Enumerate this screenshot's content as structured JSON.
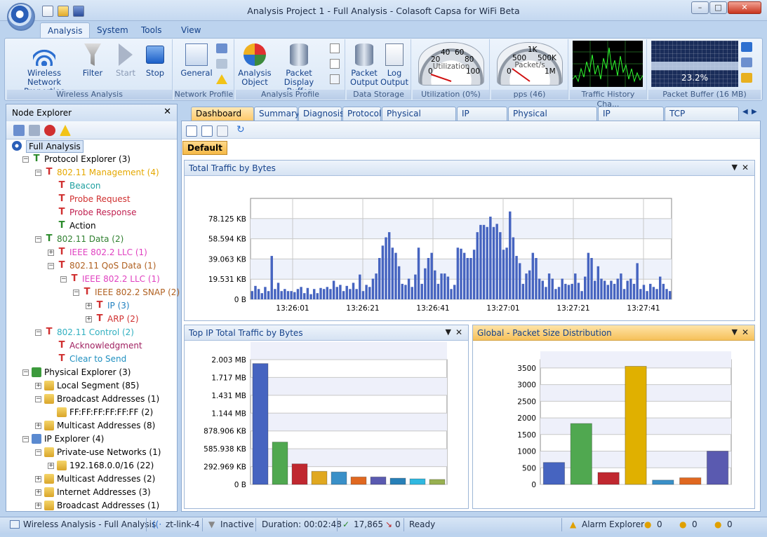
{
  "window": {
    "title": "Analysis Project 1 - Full Analysis - Colasoft Capsa for WiFi Beta"
  },
  "ribbon_tabs": [
    "Analysis",
    "System",
    "Tools",
    "View"
  ],
  "ribbon": {
    "wireless_network_properties": "Wireless Network Properties",
    "filter": "Filter",
    "start": "Start",
    "stop": "Stop",
    "general": "General",
    "analysis_object": "Analysis Object",
    "packet_display_buffer": "Packet Display Buffer",
    "packet_output": "Packet Output",
    "log_output": "Log Output",
    "groups": [
      "Wireless Analysis",
      "Network Profile",
      "Analysis Profile",
      "Data Storage",
      "Utilization (0%)",
      "pps (46)",
      "Traffic History Cha...",
      "Packet Buffer (16 MB)"
    ],
    "utilization_label": "Utilization",
    "utilization_ticks": [
      "0",
      "20",
      "40",
      "60",
      "80",
      "100"
    ],
    "pps_label": "Packet/s",
    "pps_ticks": [
      "0",
      "500",
      "1K",
      "500K",
      "1M"
    ],
    "buffer_percent": "23.2%"
  },
  "node_explorer": {
    "title": "Node Explorer",
    "tree": [
      {
        "label": "Full Analysis",
        "level": 0,
        "color": "#000000"
      },
      {
        "label": "Protocol Explorer (3)",
        "level": 1,
        "color": "#000000"
      },
      {
        "label": "802.11 Management (4)",
        "level": 2,
        "color": "#e5a800"
      },
      {
        "label": "Beacon",
        "level": 3,
        "color": "#20a0a0"
      },
      {
        "label": "Probe Request",
        "level": 3,
        "color": "#d03030"
      },
      {
        "label": "Probe Response",
        "level": 3,
        "color": "#c02050"
      },
      {
        "label": "Action",
        "level": 3,
        "color": "#000000"
      },
      {
        "label": "802.11 Data (2)",
        "level": 2,
        "color": "#308030"
      },
      {
        "label": "IEEE 802.2 LLC (1)",
        "level": 3,
        "color": "#e040c0"
      },
      {
        "label": "802.11 QoS Data (1)",
        "level": 3,
        "color": "#b06020"
      },
      {
        "label": "IEEE 802.2 LLC (1)",
        "level": 4,
        "color": "#e040c0"
      },
      {
        "label": "IEEE 802.2 SNAP (2)",
        "level": 5,
        "color": "#b06020"
      },
      {
        "label": "IP (3)",
        "level": 6,
        "color": "#2080c0"
      },
      {
        "label": "ARP (2)",
        "level": 6,
        "color": "#d03030"
      },
      {
        "label": "802.11 Control (2)",
        "level": 2,
        "color": "#30b0c0"
      },
      {
        "label": "Acknowledgment",
        "level": 3,
        "color": "#a02060"
      },
      {
        "label": "Clear to Send",
        "level": 3,
        "color": "#2090c0"
      },
      {
        "label": "Physical Explorer (3)",
        "level": 1,
        "color": "#000000"
      },
      {
        "label": "Local Segment (85)",
        "level": 2,
        "color": "#000000"
      },
      {
        "label": "Broadcast Addresses (1)",
        "level": 2,
        "color": "#000000"
      },
      {
        "label": "FF:FF:FF:FF:FF:FF (2)",
        "level": 3,
        "color": "#000000"
      },
      {
        "label": "Multicast Addresses (8)",
        "level": 2,
        "color": "#000000"
      },
      {
        "label": "IP Explorer (4)",
        "level": 1,
        "color": "#000000"
      },
      {
        "label": "Private-use Networks (1)",
        "level": 2,
        "color": "#000000"
      },
      {
        "label": "192.168.0.0/16 (22)",
        "level": 3,
        "color": "#000000"
      },
      {
        "label": "Multicast Addresses (2)",
        "level": 2,
        "color": "#000000"
      },
      {
        "label": "Internet Addresses (3)",
        "level": 2,
        "color": "#000000"
      },
      {
        "label": "Broadcast Addresses (1)",
        "level": 2,
        "color": "#000000"
      }
    ]
  },
  "doc_tabs": [
    "Dashboard",
    "Summary",
    "Diagnosis",
    "Protocol",
    "Physical Endpoint",
    "IP Endpoint",
    "Physical Conversation",
    "IP Conversation",
    "TCP Conversation"
  ],
  "dashboard": {
    "default_tab": "Default"
  },
  "chart_data": [
    {
      "type": "bar",
      "title": "Total Traffic by Bytes",
      "x_ticks": [
        "13:26:01",
        "13:26:21",
        "13:26:41",
        "13:27:01",
        "13:27:21",
        "13:27:41"
      ],
      "y_ticks": [
        "0 B",
        "19.531 KB",
        "39.063 KB",
        "58.594 KB",
        "78.125 KB"
      ],
      "ylim": [
        0,
        97.656
      ],
      "color": "#4664c0",
      "values_kb": [
        8,
        13,
        10,
        6,
        12,
        8,
        42,
        10,
        16,
        8,
        10,
        8,
        8,
        7,
        10,
        12,
        6,
        11,
        5,
        10,
        6,
        11,
        10,
        12,
        10,
        18,
        12,
        14,
        8,
        13,
        10,
        16,
        10,
        24,
        8,
        14,
        12,
        20,
        25,
        40,
        52,
        60,
        65,
        50,
        45,
        32,
        15,
        14,
        20,
        12,
        24,
        50,
        15,
        30,
        40,
        45,
        28,
        15,
        25,
        25,
        22,
        10,
        14,
        50,
        49,
        45,
        40,
        40,
        48,
        65,
        72,
        72,
        70,
        80,
        70,
        73,
        65,
        48,
        50,
        85,
        60,
        42,
        35,
        15,
        25,
        28,
        45,
        40,
        20,
        18,
        12,
        25,
        20,
        10,
        12,
        20,
        15,
        14,
        15,
        25,
        16,
        8,
        22,
        45,
        40,
        18,
        32,
        20,
        18,
        14,
        18,
        15,
        20,
        25,
        10,
        18,
        20,
        15,
        35,
        10,
        14,
        8,
        15,
        12,
        10,
        22,
        15,
        10,
        8
      ]
    },
    {
      "type": "bar",
      "title": "Top IP Total Traffic by Bytes",
      "y_ticks": [
        "0 B",
        "292.969 KB",
        "585.938 KB",
        "878.906 KB",
        "1.144 MB",
        "1.431 MB",
        "1.717 MB",
        "2.003 MB"
      ],
      "ylim": [
        0,
        2.003
      ],
      "values_mb": [
        1.94,
        0.68,
        0.33,
        0.21,
        0.2,
        0.12,
        0.12,
        0.1,
        0.09,
        0.08
      ],
      "colors": [
        "#4664c0",
        "#50a850",
        "#c02830",
        "#e0a820",
        "#3a90c8",
        "#e06820",
        "#5a5ab0",
        "#2880b8",
        "#30b8e0",
        "#98b050"
      ]
    },
    {
      "type": "bar",
      "title": "Global - Packet Size Distribution",
      "y_ticks": [
        "0",
        "500",
        "1000",
        "1500",
        "2000",
        "2500",
        "3000",
        "3500"
      ],
      "ylim": [
        0,
        3750
      ],
      "values": [
        660,
        1830,
        360,
        3550,
        130,
        200,
        1000
      ],
      "colors": [
        "#4664c0",
        "#50a850",
        "#c02830",
        "#e0b000",
        "#3a90c8",
        "#e06820",
        "#5a5ab0"
      ]
    }
  ],
  "status": {
    "project": "Wireless Analysis - Full Analysis",
    "network": "zt-link-4",
    "filter_state": "Inactive",
    "duration": "Duration: 00:02:48",
    "packets": "17,865",
    "dropped": "0",
    "state": "Ready",
    "alarm": "Alarm Explorer",
    "alarm_counts": [
      "0",
      "0",
      "0"
    ]
  }
}
